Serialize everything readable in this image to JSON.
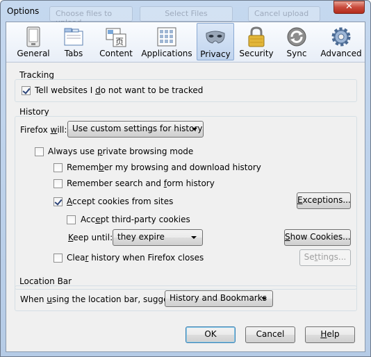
{
  "window": {
    "title": "Options",
    "close_glyph": "✕",
    "ghost_upload": "Choose files to upload",
    "ghost_select": "Select Files",
    "ghost_cancel": "Cancel upload"
  },
  "panes": [
    {
      "label": "General",
      "icon": "general-icon"
    },
    {
      "label": "Tabs",
      "icon": "tabs-icon"
    },
    {
      "label": "Content",
      "icon": "content-icon"
    },
    {
      "label": "Applications",
      "icon": "applications-icon"
    },
    {
      "label": "Privacy",
      "icon": "privacy-mask-icon",
      "selected": true
    },
    {
      "label": "Security",
      "icon": "lock-icon"
    },
    {
      "label": "Sync",
      "icon": "sync-icon"
    },
    {
      "label": "Advanced",
      "icon": "gear-icon"
    }
  ],
  "tracking": {
    "title": "Tracking",
    "dnt_pre": "Tell websites I ",
    "dnt_key": "d",
    "dnt_post": "o not want to be tracked",
    "dnt_checked": true
  },
  "history": {
    "title": "History",
    "firefox_will_pre": "Firefox ",
    "firefox_will_key": "w",
    "firefox_will_post": "ill:",
    "mode_value": "Use custom settings for history",
    "private_pre": "Always use ",
    "private_key": "p",
    "private_post": "rivate browsing mode",
    "private_checked": false,
    "browsing_pre": "Remem",
    "browsing_key": "b",
    "browsing_post": "er my browsing and download history",
    "browsing_checked": false,
    "search_pre": "Remember search and ",
    "search_key": "f",
    "search_post": "orm history",
    "search_checked": false,
    "cookies_pre": "",
    "cookies_key": "A",
    "cookies_post": "ccept cookies from sites",
    "cookies_checked": true,
    "exceptions_pre": "",
    "exceptions_key": "E",
    "exceptions_post": "xceptions...",
    "thirdparty_pre": "Acc",
    "thirdparty_key": "e",
    "thirdparty_post": "pt third-party cookies",
    "thirdparty_checked": false,
    "keepuntil_pre": "",
    "keepuntil_key": "K",
    "keepuntil_post": "eep until:",
    "keepuntil_value": "they expire",
    "showcookies_pre": "",
    "showcookies_key": "S",
    "showcookies_post": "how Cookies...",
    "clear_pre": "Clea",
    "clear_key": "r",
    "clear_post": " history when Firefox closes",
    "clear_checked": false,
    "settings_pre": "Se",
    "settings_key": "t",
    "settings_post": "tings..."
  },
  "location": {
    "title": "Location Bar",
    "suggest_pre": "When ",
    "suggest_key": "u",
    "suggest_post": "sing the location bar, suggest:",
    "suggest_value": "History and Bookmarks"
  },
  "buttons": {
    "ok": "OK",
    "cancel": "Cancel",
    "help_key": "H",
    "help_post": "elp"
  }
}
